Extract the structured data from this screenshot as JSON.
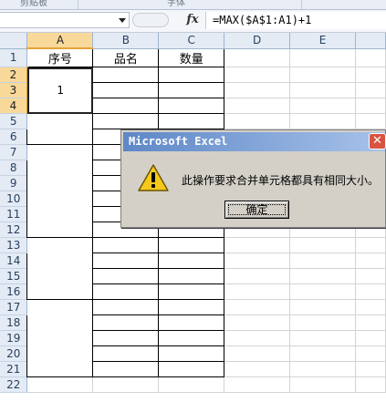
{
  "ribbon": {
    "group_left": "剪贴板",
    "group_mid": "字体"
  },
  "formula_bar": {
    "name_box": "",
    "fx_label": "fx",
    "formula": "=MAX($A$1:A1)+1"
  },
  "columns": [
    "A",
    "B",
    "C",
    "D",
    "E"
  ],
  "rows": [
    "1",
    "2",
    "3",
    "4",
    "5",
    "6",
    "7",
    "8",
    "9",
    "10",
    "11",
    "12",
    "13",
    "14",
    "15",
    "16",
    "17",
    "18",
    "19",
    "20",
    "21",
    "22"
  ],
  "cells": {
    "a1": "序号",
    "b1": "品名",
    "c1": "数量",
    "a2_merged": "1"
  },
  "dialog": {
    "title": "Microsoft Excel",
    "close_glyph": "✕",
    "message": "此操作要求合并单元格都具有相同大小。",
    "ok_label": "确定"
  },
  "colors": {
    "selected_header": "#f9d99a",
    "header_bg": "#e4ebf5",
    "dialog_title_start": "#5e87c6",
    "dialog_title_end": "#a7c2ea",
    "close_button": "#d9533f",
    "warning_yellow": "#f6c81c"
  },
  "icons": {
    "dialog_icon": "warning-icon",
    "name_box_arrow": "chevron-down-icon",
    "function_icon": "fx-icon"
  }
}
